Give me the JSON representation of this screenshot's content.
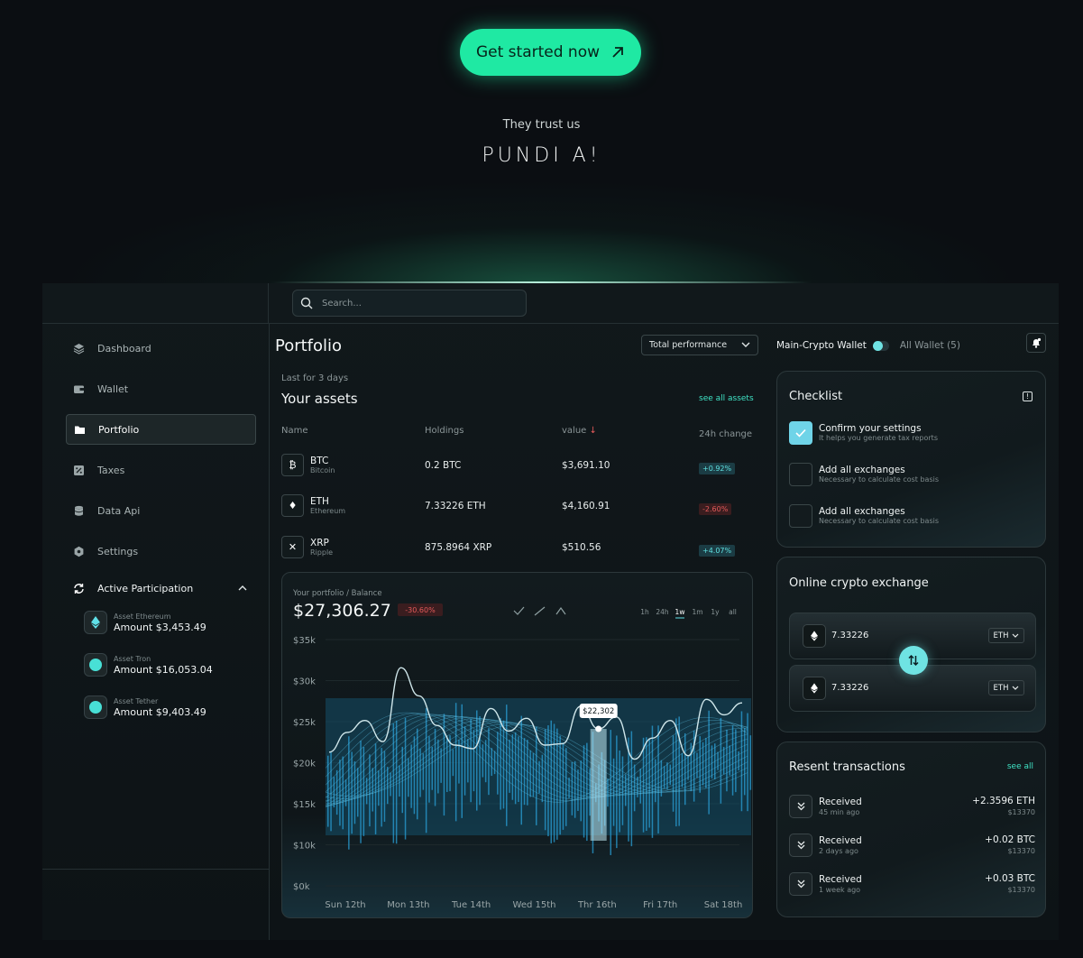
{
  "hero": {
    "cta_label": "Get started now",
    "trust_label": "They trust us",
    "brand": "PUNDI A!"
  },
  "search": {
    "placeholder": "Search..."
  },
  "sidebar": {
    "items": [
      {
        "label": "Dashboard",
        "icon": "layers-icon"
      },
      {
        "label": "Wallet",
        "icon": "wallet-icon"
      },
      {
        "label": "Portfolio",
        "icon": "folder-icon",
        "active": true
      },
      {
        "label": "Taxes",
        "icon": "percent-icon"
      },
      {
        "label": "Data Api",
        "icon": "database-icon"
      },
      {
        "label": "Settings",
        "icon": "gear-icon"
      }
    ],
    "participation": {
      "label": "Active Participation",
      "assets": [
        {
          "label": "Asset Ethereum",
          "amount": "Amount $3,453.49",
          "icon": "ethereum-icon"
        },
        {
          "label": "Asset Tron",
          "amount": "Amount $16,053.04",
          "icon": "tron-icon"
        },
        {
          "label": "Asset Tether",
          "amount": "Amount $9,403.49",
          "icon": "tether-icon"
        }
      ]
    }
  },
  "portfolio": {
    "title": "Portfolio",
    "perf_select": "Total performance",
    "period": "Last for 3 days",
    "assets_title": "Your assets",
    "see_all": "see all assets",
    "columns": [
      "Name",
      "Holdings",
      "value",
      "24h change"
    ],
    "rows": [
      {
        "symbol": "BTC",
        "name": "Bitcoin",
        "icon_glyph": "₿",
        "holdings": "0.2 BTC",
        "value": "$3,691.10",
        "change": "+0.92%",
        "dir": "pos"
      },
      {
        "symbol": "ETH",
        "name": "Ethereum",
        "icon_glyph": "♦",
        "holdings": "7.33226 ETH",
        "value": "$4,160.91",
        "change": "-2.60%",
        "dir": "neg"
      },
      {
        "symbol": "XRP",
        "name": "Ripple",
        "icon_glyph": "✕",
        "holdings": "875.8964 XRP",
        "value": "$510.56",
        "change": "+4.07%",
        "dir": "pos"
      }
    ]
  },
  "chart_data": {
    "type": "area",
    "subtitle": "Your portfolio / Balance",
    "balance": "$27,306.27",
    "balance_change": "-30.60%",
    "ranges": [
      "1h",
      "24h",
      "1w",
      "1m",
      "1y",
      "all"
    ],
    "selected_range": "1w",
    "categories": [
      "Sun 12th",
      "Mon 13th",
      "Tue 14th",
      "Wed 15th",
      "Thr 16th",
      "Fri 17th",
      "Sat 18th"
    ],
    "y_ticks": [
      "$35k",
      "$30k",
      "$25k",
      "$20k",
      "$15k",
      "$10k",
      "$0k"
    ],
    "ylim": [
      0,
      35000
    ],
    "series": [
      {
        "values": [
          19000,
          21800,
          23500,
          20500,
          31000,
          27000,
          22800,
          20000,
          19500,
          25200,
          22000,
          23800,
          20000,
          20200,
          25500,
          22302,
          24000,
          18000,
          21000,
          23500,
          18500,
          26500,
          24300,
          26000
        ]
      }
    ],
    "tooltip": {
      "label": "$22,302",
      "value": 22302
    }
  },
  "right": {
    "wallet_main": "Main-Crypto Wallet",
    "wallet_all": "All Wallet (5)",
    "checklist": {
      "title": "Checklist",
      "items": [
        {
          "title": "Confirm your settings",
          "sub": "It helps you generate tax reports",
          "done": true
        },
        {
          "title": "Add all exchanges",
          "sub": "Necessary to calculate cost basis",
          "done": false
        },
        {
          "title": "Add all exchanges",
          "sub": "Necessary to calculate cost basis",
          "done": false
        }
      ]
    },
    "exchange": {
      "title": "Online crypto exchange",
      "from_amount": "7.33226",
      "from_currency": "ETH",
      "to_amount": "7.33226",
      "to_currency": "ETH"
    },
    "transactions": {
      "title": "Resent transactions",
      "see_all": "see all",
      "items": [
        {
          "title": "Received",
          "time": "45 min ago",
          "amount": "+2.3596 ETH",
          "usd": "$13370"
        },
        {
          "title": "Received",
          "time": "2 days ago",
          "amount": "+0.02 BTC",
          "usd": "$13370"
        },
        {
          "title": "Received",
          "time": "1 week ago",
          "amount": "+0.03 BTC",
          "usd": "$13370"
        }
      ]
    }
  },
  "colors": {
    "accent": "#1fe9a3",
    "cyan": "#3fe3c5",
    "negative": "#e35a5a"
  }
}
